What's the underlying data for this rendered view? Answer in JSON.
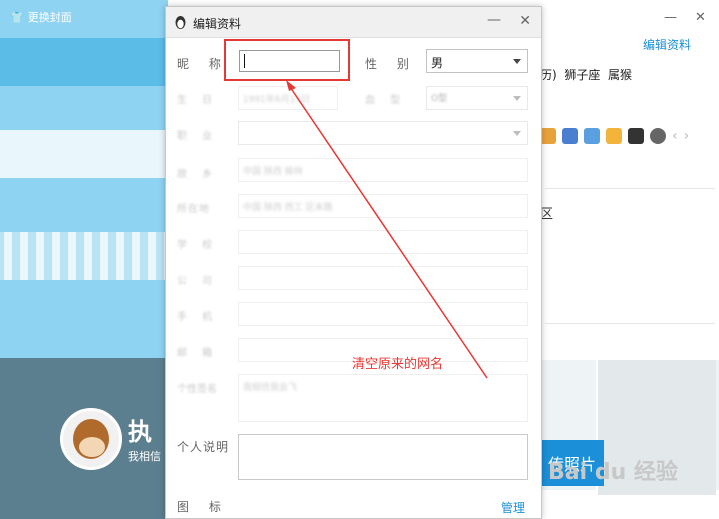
{
  "background_window": {
    "change_cover_label": "更换封面",
    "edit_profile_link": "编辑资料",
    "info_items": [
      "历)",
      "狮子座",
      "属猴"
    ],
    "district_text": "区",
    "name_partial": "执",
    "motto_partial": "我相信",
    "upload_button_label": "传照片",
    "watermark_text": "Bai du 经验",
    "minimize_symbol": "—",
    "close_symbol": "✕",
    "nav_prev_symbol": "‹",
    "nav_next_symbol": "›"
  },
  "dialog": {
    "title": "编辑资料",
    "minimize_symbol": "—",
    "close_symbol": "✕",
    "nickname_label": "昵 称",
    "nickname_value": "",
    "gender_label": "性 别",
    "gender_value": "男",
    "birthday_label": "生 日",
    "birthday_value": "1991年6月15日",
    "blood_label": "血 型",
    "blood_value": "O型",
    "occupation_label": "职 业",
    "hometown_label": "故 乡",
    "hometown_value": "中国 陕西 榆林",
    "location_label": "所在地",
    "location_value": "中国 陕西 西工  区未路",
    "school_label": "学 校",
    "company_label": "公 司",
    "phone_label": "手 机",
    "email_label": "邮 箱",
    "signature_label": "个性签名",
    "signature_value": "我相信我会飞",
    "personal_desc_label": "个人说明",
    "icon_label": "图 标",
    "manage_link": "管理"
  },
  "annotation": {
    "text": "清空原来的网名",
    "color": "#e53935"
  },
  "colors": {
    "accent_blue": "#1a8fd6",
    "cover_blue": "#8fd3f3",
    "profile_dark": "#5c7f8f"
  }
}
